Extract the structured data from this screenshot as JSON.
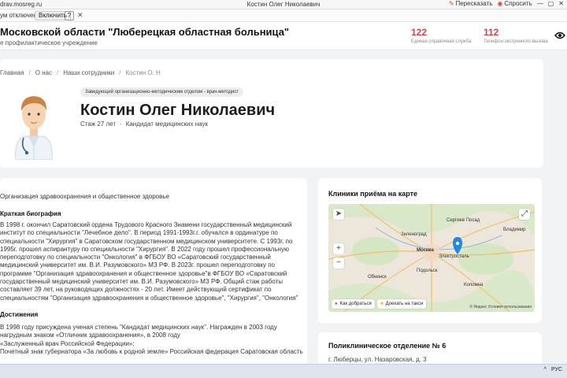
{
  "browser": {
    "url": "drav.mosreg.ru",
    "tab_title": "Костин Олег Николаевич",
    "share_label": "Пересказать",
    "ask_label": "Спросить"
  },
  "extension_bar": {
    "label": "ум отключена",
    "enable_button": "Включить"
  },
  "header": {
    "org_name": "Московской области \"Люберецкая областная больница\"",
    "org_type": "е профилактическое учреждение",
    "phones": [
      {
        "number": "122",
        "label": "Единая справочная служба"
      },
      {
        "number": "112",
        "label": "Телефон экстренного вызова"
      }
    ]
  },
  "breadcrumb": {
    "items": [
      "Главная",
      "О нас",
      "Наши сотрудники",
      "Костин О. Н"
    ]
  },
  "doctor": {
    "position": "Заведующий организационно-методическим отделом - врач-методист",
    "name": "Костин Олег Николаевич",
    "experience": "Стаж 27 лет",
    "degree": "Кандидат медицинских наук"
  },
  "bio": {
    "specialty": "Организация здравоохранения и общественное здоровье",
    "bio_heading": "Краткая биография",
    "bio_lines": [
      "В 1998 г. окончил Саратовский ордена Трудового Красного Знамени государственный медицинский",
      "институт по специальности \"Лечебное дело\". В период 1991-1993г.г. обучался в ординатуре по",
      "специальности \"Хирургия\" в Саратовском государственном медицинском университете. С 1993г. по",
      "1995г. прошел аспирантуру по специальности \"Хирургия\".  В 2022 году прошел профессиональную",
      "переподготовку по специальности \"Онкология\" в ФГБОУ ВО «Саратовский государственный",
      "медицинский университет им. В.И. Разумовского» МЗ РФ. В 2023г. прошел переподготовку по",
      "программе \"Организация здравоохранения и общественное здоровье\"в ФГБОУ ВО «Саратовский",
      "государственный медицинский университет им. В.И. Разумовского» МЗ РФ. Общий стаж работы",
      "составляет 39 лет, на руководящих должностях - 20 лет. Имеет действующий сертификат по",
      "специальностям \"Организация здравоохранения и общественное здоровье\", \"Хирургия\", \"Онкология\""
    ],
    "achievements_heading": "Достижения",
    "achievement_lines": [
      "В 1998 году присуждена ученая степень \"Кандидат медицинских наук\". Награжден в 2003 году",
      "нагрудным знаком «Отличник здравоохранения», в 2008 году",
      "«Заслуженный врач Российской Федерации»;",
      "Почетный знак губернатора «За любовь к родной земле» Российская федерация Саратовская область"
    ]
  },
  "map": {
    "heading": "Клиники приёма на карте",
    "route_button": "Как добраться",
    "taxi_button": "Доехать на такси",
    "copyright": "© Яндекс Условия использования",
    "labels": [
      "Москва",
      "Электросталь",
      "Подольск",
      "Зеленоград",
      "Владимир",
      "Сергиев Посад",
      "Коломна",
      "Обнинск"
    ]
  },
  "clinic": {
    "heading": "Поликлиническое отделение № 6",
    "address": "г. Люберцы, ул. Назаровская, д. 3"
  },
  "taskbar": {
    "language": "РУС"
  },
  "colors": {
    "accent_red": "#d64545",
    "background": "#f2f3f5",
    "card": "#ffffff"
  }
}
